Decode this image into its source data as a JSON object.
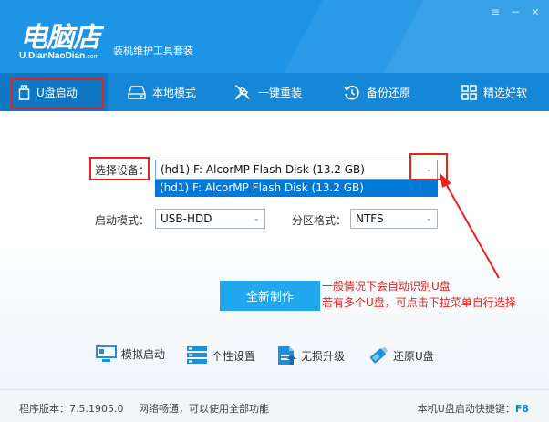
{
  "brand": {
    "logo_text": "电脑店",
    "logo_domain_1": "U",
    "logo_domain_dot": ".",
    "logo_domain_2": "DianNaoDian",
    "logo_domain_suffix": ".com",
    "slogan": "装机维护工具套装"
  },
  "window_controls": {
    "menu": "≡",
    "minimize": "−",
    "close": "×"
  },
  "nav": {
    "items": [
      {
        "label": "U盘启动",
        "icon": "usb-drive-icon",
        "active": true
      },
      {
        "label": "本地模式",
        "icon": "hard-disk-icon",
        "active": false
      },
      {
        "label": "一键重装",
        "icon": "tools-icon",
        "active": false
      },
      {
        "label": "备份还原",
        "icon": "restore-icon",
        "active": false
      },
      {
        "label": "精选好软",
        "icon": "apps-grid-icon",
        "active": false
      }
    ]
  },
  "form": {
    "device_label": "选择设备：",
    "device_value": "(hd1) F: AlcorMP Flash Disk (13.2 GB)",
    "device_options": [
      "(hd1) F: AlcorMP Flash Disk (13.2 GB)"
    ],
    "boot_mode_label": "启动模式：",
    "boot_mode_value": "USB-HDD",
    "partition_label": "分区格式：",
    "partition_value": "NTFS",
    "arrow_glyph": "⌄"
  },
  "action": {
    "make_label": "全新制作"
  },
  "tips": {
    "line1": "一般情况下会自动识别U盘",
    "line2": "若有多个U盘，可点击下拉菜单自行选择"
  },
  "tools": [
    {
      "label": "模拟启动",
      "icon": "monitor-icon"
    },
    {
      "label": "个性设置",
      "icon": "settings-list-icon"
    },
    {
      "label": "无损升级",
      "icon": "upgrade-icon"
    },
    {
      "label": "还原U盘",
      "icon": "usb-stick-icon"
    }
  ],
  "status": {
    "version": "程序版本：7.5.1905.0",
    "network": "网络畅通，可以使用全部功能",
    "hotkey_label": "本机U盘启动快捷键：",
    "hotkey_value": "F8"
  },
  "colors": {
    "header": "#1d94e6",
    "nav": "#1587d6",
    "accent": "#20a7ec",
    "annotation": "#e8231d",
    "selection": "#0078d7"
  }
}
